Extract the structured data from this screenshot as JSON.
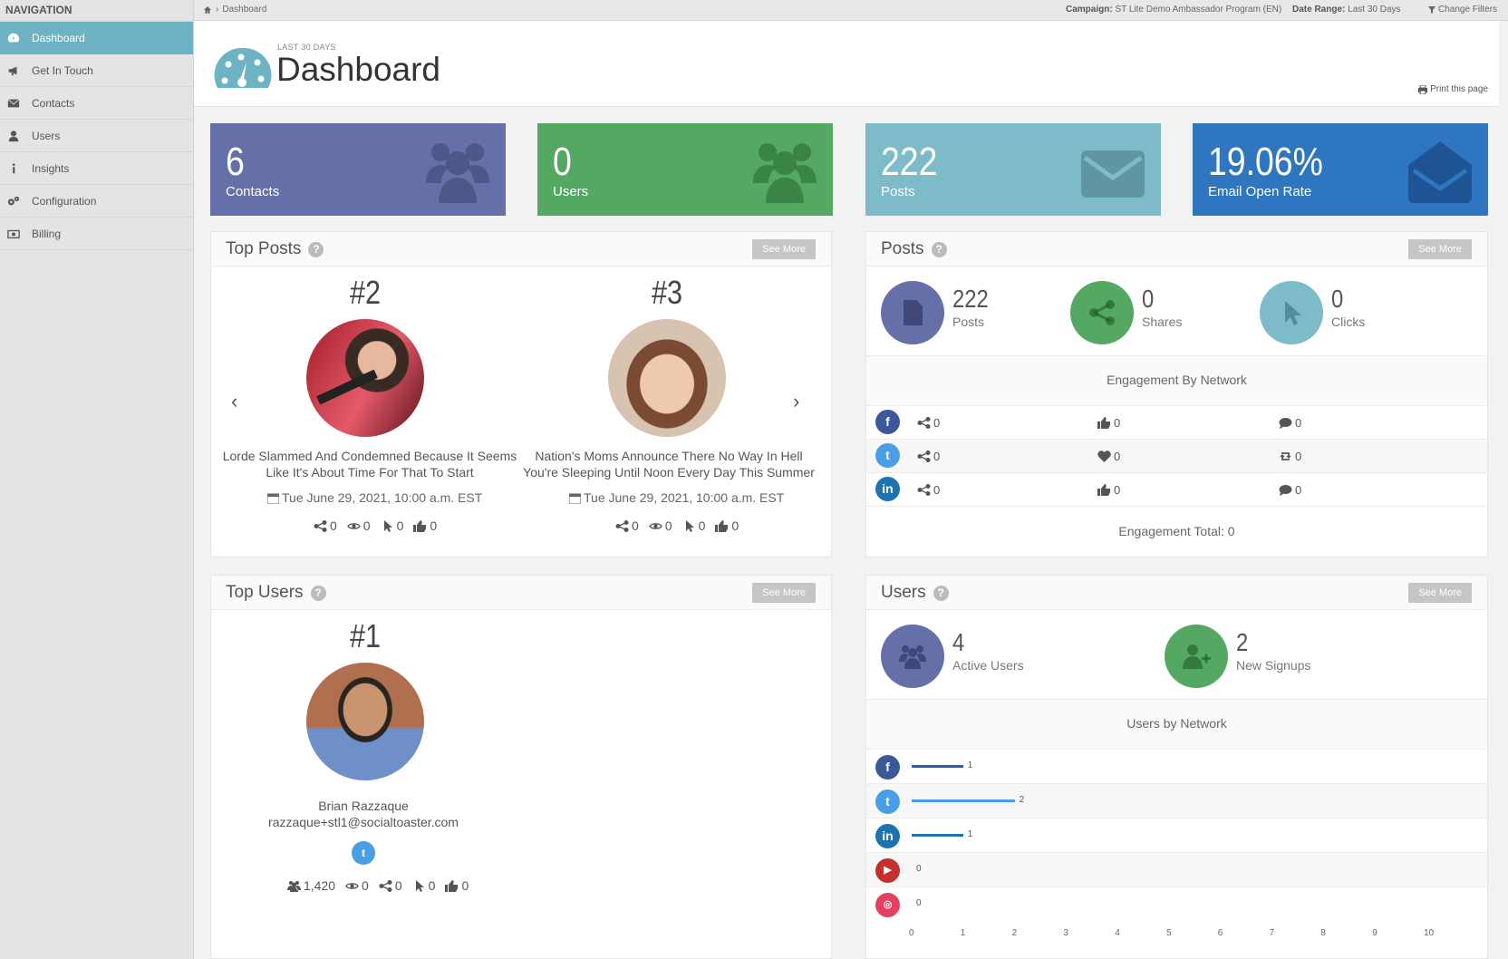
{
  "nav": {
    "title": "NAVIGATION",
    "items": [
      {
        "label": "Dashboard",
        "icon": "dashboard-icon"
      },
      {
        "label": "Get In Touch",
        "icon": "megaphone-icon"
      },
      {
        "label": "Contacts",
        "icon": "envelope-icon"
      },
      {
        "label": "Users",
        "icon": "user-icon"
      },
      {
        "label": "Insights",
        "icon": "info-icon"
      },
      {
        "label": "Configuration",
        "icon": "gears-icon"
      },
      {
        "label": "Billing",
        "icon": "money-icon"
      }
    ]
  },
  "topbar": {
    "breadcrumb": "Dashboard",
    "campaign_label": "Campaign:",
    "campaign_value": "ST Lite Demo Ambassador Program (EN)",
    "range_label": "Date Range:",
    "range_value": "Last 30 Days",
    "filters": "Change Filters"
  },
  "header": {
    "sub": "LAST 30 DAYS",
    "title": "Dashboard",
    "print": "Print this page"
  },
  "stats": [
    {
      "value": "6",
      "label": "Contacts",
      "color": "#6670a8"
    },
    {
      "value": "0",
      "label": "Users",
      "color": "#55a861"
    },
    {
      "value": "222",
      "label": "Posts",
      "color": "#7dbbc8"
    },
    {
      "value": "19.06%",
      "label": "Email Open Rate",
      "color": "#2e76bf"
    }
  ],
  "top_posts": {
    "title": "Top Posts",
    "see_more": "See More",
    "items": [
      {
        "rank": "#2",
        "text1": "Lorde Slammed And Condemned Because It Seems",
        "text2": "Like It's About Time For That To Start",
        "date": "Tue June 29, 2021, 10:00 a.m. EST",
        "shares": "0",
        "views": "0",
        "clicks": "0",
        "likes": "0"
      },
      {
        "rank": "#3",
        "text1": "Nation's Moms Announce There No Way In Hell",
        "text2": "You're Sleeping Until Noon Every Day This Summer",
        "date": "Tue June 29, 2021, 10:00 a.m. EST",
        "shares": "0",
        "views": "0",
        "clicks": "0",
        "likes": "0"
      }
    ]
  },
  "posts": {
    "title": "Posts",
    "see_more": "See More",
    "totals": [
      {
        "value": "222",
        "label": "Posts",
        "color": "#6670a8"
      },
      {
        "value": "0",
        "label": "Shares",
        "color": "#55a861"
      },
      {
        "value": "0",
        "label": "Clicks",
        "color": "#7dbbc8"
      }
    ],
    "engagement_title": "Engagement By Network",
    "networks": [
      {
        "name": "facebook",
        "color": "#3b5998",
        "glyph": "f",
        "shares": "0",
        "likes": "0",
        "comments": "0"
      },
      {
        "name": "twitter",
        "color": "#4a9ee6",
        "glyph": "t",
        "shares": "0",
        "likes": "0",
        "comments": "0"
      },
      {
        "name": "linkedin",
        "color": "#1d72b0",
        "glyph": "in",
        "shares": "0",
        "likes": "0",
        "comments": "0"
      }
    ],
    "engagement_total": "Engagement Total: 0"
  },
  "top_users": {
    "title": "Top Users",
    "see_more": "See More",
    "rank": "#1",
    "name": "Brian Razzaque",
    "email": "razzaque+stl1@socialtoaster.com",
    "reach": "1,420",
    "views": "0",
    "shares": "0",
    "clicks": "0",
    "likes": "0"
  },
  "users": {
    "title": "Users",
    "see_more": "See More",
    "active_value": "4",
    "active_label": "Active Users",
    "signups_value": "2",
    "signups_label": "New Signups",
    "network_title": "Users by Network",
    "chart_data": {
      "type": "bar",
      "orientation": "horizontal",
      "categories": [
        "facebook",
        "twitter",
        "linkedin",
        "youtube",
        "instagram"
      ],
      "values": [
        1,
        2,
        1,
        0,
        0
      ],
      "xlim": [
        0,
        10
      ],
      "xticks": [
        "0",
        "1",
        "2",
        "3",
        "4",
        "5",
        "6",
        "7",
        "8",
        "9",
        "10"
      ],
      "colors": [
        "#3b5998",
        "#4a9ee6",
        "#1d72b0",
        "#c4302b",
        "#e4405f"
      ]
    }
  }
}
